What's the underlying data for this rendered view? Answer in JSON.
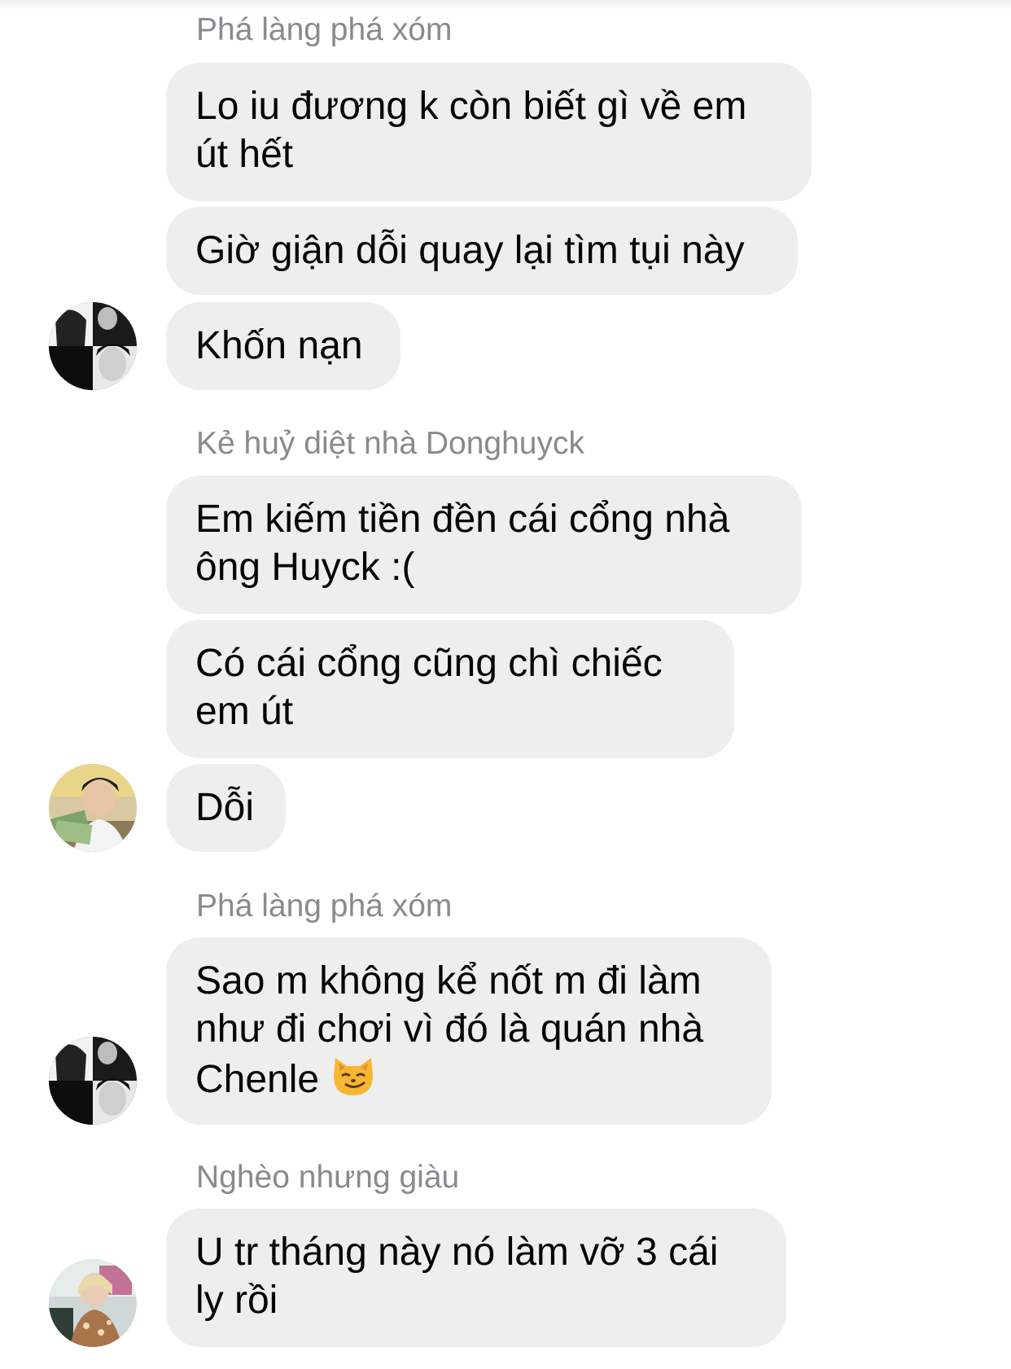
{
  "messages": [
    {
      "sender": "Phá làng phá xóm"
    },
    {
      "text": "Lo iu đương k còn biết gì về em út hết"
    },
    {
      "text": "Giờ giận dỗi quay lại tìm tụi này"
    },
    {
      "text": "Khốn nạn"
    },
    {
      "sender": "Kẻ huỷ diệt nhà Donghuyck"
    },
    {
      "text": "Em kiếm tiền đền cái cổng nhà ông Huyck :("
    },
    {
      "text": "Có cái cổng cũng chì chiếc em út"
    },
    {
      "text": "Dỗi"
    },
    {
      "sender": "Phá làng phá xóm"
    },
    {
      "text": "Sao m không kể nốt m đi làm như đi chơi vì đó là quán nhà Chenle",
      "emoji": "smirking-cat-face"
    },
    {
      "sender": "Nghèo nhưng giàu"
    },
    {
      "text": "U tr tháng này nó làm vỡ 3 cái ly rồi"
    }
  ],
  "colors": {
    "bubble": "#eeeeee",
    "sender": "#8a8a8e",
    "text": "#050505"
  }
}
